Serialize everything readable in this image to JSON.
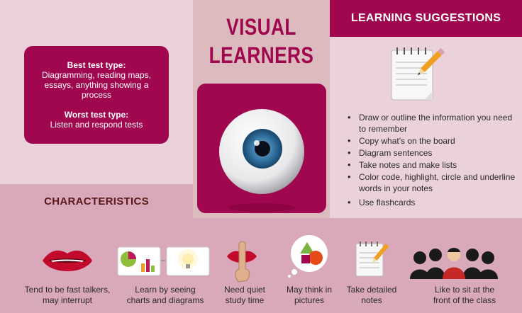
{
  "title": {
    "line1": "VISUAL",
    "line2": "LEARNERS"
  },
  "test_box": {
    "best_heading": "Best test type:",
    "best_text": "Diagramming, reading maps, essays, anything showing a process",
    "worst_heading": "Worst test type:",
    "worst_text": "Listen and respond tests"
  },
  "characteristics": {
    "heading": "CHARACTERISTICS",
    "items": [
      {
        "icon": "lips-icon",
        "line1": "Tend to be fast talkers,",
        "line2": "may interrupt"
      },
      {
        "icon": "charts-icon",
        "line1": "Learn by seeing",
        "line2": "charts and diagrams"
      },
      {
        "icon": "finger-on-lips-icon",
        "line1": "Need quiet",
        "line2": "study time"
      },
      {
        "icon": "thought-bubble-shapes-icon",
        "line1": "May think in",
        "line2": "pictures"
      },
      {
        "icon": "notepad-icon",
        "line1": "Take detailed",
        "line2": "notes"
      },
      {
        "icon": "classroom-front-row-icon",
        "line1": "Like to sit at the",
        "line2": "front of the class"
      }
    ]
  },
  "suggestions": {
    "heading": "LEARNING SUGGESTIONS",
    "items": [
      "Draw or outline the information you need to remember",
      "Copy what's on the board",
      "Diagram sentences",
      "Take notes and make lists",
      "Color code, highlight, circle and underline words in your notes",
      "Use flashcards"
    ]
  },
  "colors": {
    "accent": "#a0074e",
    "panel_light": "#ebd2da",
    "panel_mid": "#d9a8bb",
    "panel_center": "#dcbbbe",
    "heading_brown": "#5a1a1a"
  }
}
